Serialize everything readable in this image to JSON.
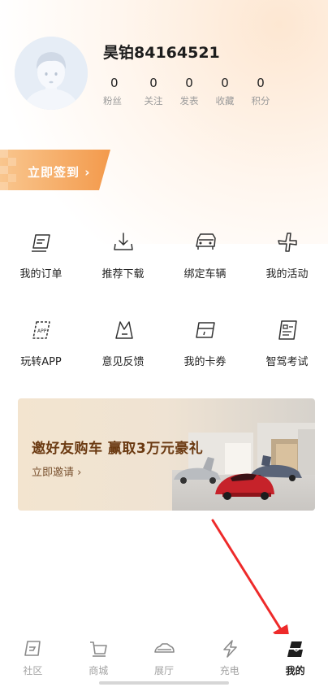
{
  "profile": {
    "username": "昊铂84164521",
    "stats": [
      {
        "value": "0",
        "label": "粉丝"
      },
      {
        "value": "0",
        "label": "关注"
      },
      {
        "value": "0",
        "label": "发表"
      },
      {
        "value": "0",
        "label": "收藏"
      },
      {
        "value": "0",
        "label": "积分"
      }
    ]
  },
  "checkin": {
    "label": "立即签到 ›"
  },
  "menu": [
    {
      "label": "我的订单",
      "icon": "order-icon"
    },
    {
      "label": "推荐下载",
      "icon": "download-icon"
    },
    {
      "label": "绑定车辆",
      "icon": "car-icon"
    },
    {
      "label": "我的活动",
      "icon": "activity-icon"
    },
    {
      "label": "玩转APP",
      "icon": "app-guide-icon"
    },
    {
      "label": "意见反馈",
      "icon": "feedback-icon"
    },
    {
      "label": "我的卡券",
      "icon": "coupon-icon"
    },
    {
      "label": "智驾考试",
      "icon": "exam-icon"
    }
  ],
  "promo": {
    "title": "邀好友购车 赢取3万元豪礼",
    "cta": "立即邀请 ›"
  },
  "tabbar": [
    {
      "label": "社区",
      "icon": "community-icon",
      "active": false
    },
    {
      "label": "商城",
      "icon": "cart-icon",
      "active": false
    },
    {
      "label": "展厅",
      "icon": "showroom-icon",
      "active": false
    },
    {
      "label": "充电",
      "icon": "charge-icon",
      "active": false
    },
    {
      "label": "我的",
      "icon": "profile-icon",
      "active": true
    }
  ],
  "colors": {
    "accent": "#f5a65b",
    "promo_text": "#6b3a12",
    "arrow": "#ee2a2a"
  }
}
